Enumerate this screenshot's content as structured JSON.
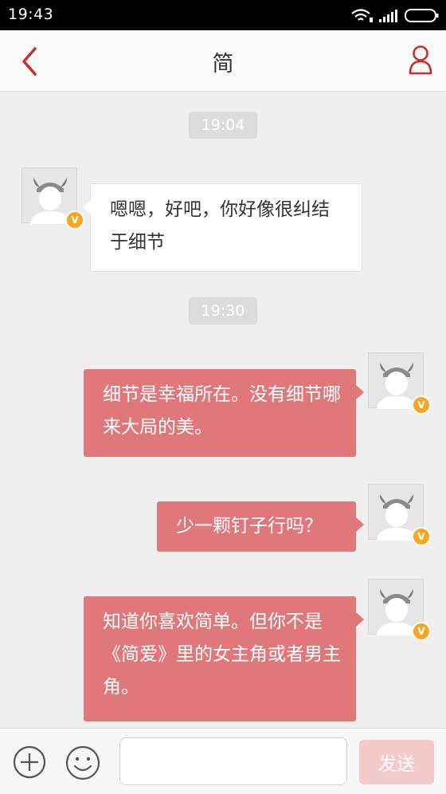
{
  "status_bar": {
    "time": "19:43",
    "icons": [
      "wifi-icon",
      "signal-icon",
      "battery-icon"
    ]
  },
  "header": {
    "title": "简",
    "back_icon": "chevron-left-icon",
    "profile_icon": "user-icon"
  },
  "colors": {
    "accent": "#c9302c",
    "outgoing_bubble": "#e0777a",
    "incoming_bubble": "#ffffff",
    "send_button_disabled": "#f3c9ca",
    "verified_badge": "#f5a623"
  },
  "messages": [
    {
      "type": "time",
      "text": "19:04"
    },
    {
      "type": "message",
      "direction": "incoming",
      "text": "嗯嗯，好吧，你好像很纠结于细节",
      "badge": "V"
    },
    {
      "type": "time",
      "text": "19:30"
    },
    {
      "type": "message",
      "direction": "outgoing",
      "text": "细节是幸福所在。没有细节哪来大局的美。",
      "badge": "V"
    },
    {
      "type": "message",
      "direction": "outgoing",
      "text": "少一颗钉子行吗？",
      "badge": "V"
    },
    {
      "type": "message",
      "direction": "outgoing",
      "text": "知道你喜欢简单。但你不是《简爱》里的女主角或者男主角。",
      "badge": "V"
    }
  ],
  "input_bar": {
    "plus_icon": "plus-circle-icon",
    "emoji_icon": "emoji-icon",
    "input_value": "",
    "send_label": "发送"
  }
}
